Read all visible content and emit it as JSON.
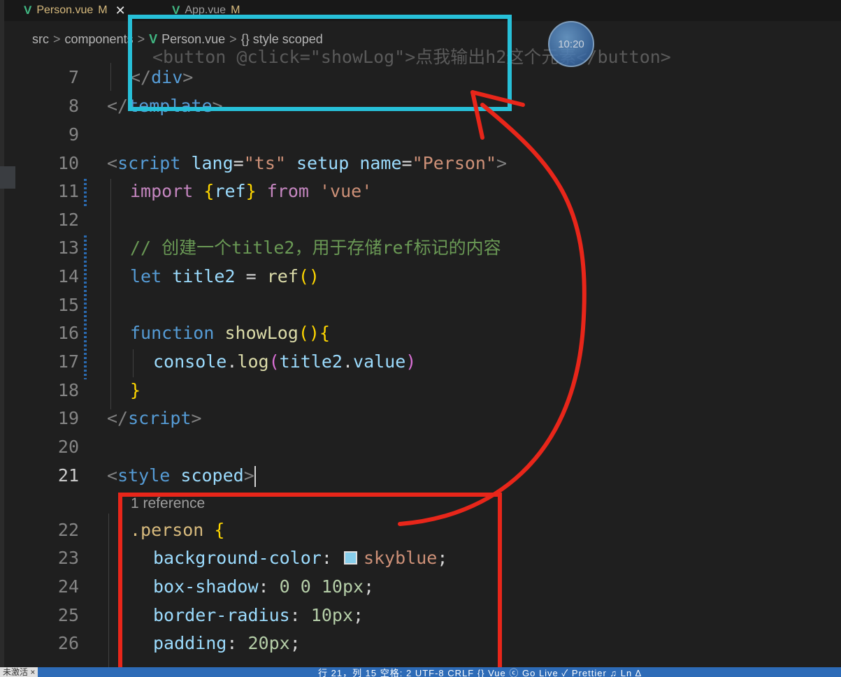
{
  "tabs": [
    {
      "label": "Person.vue",
      "modified": "M",
      "close": "✕"
    },
    {
      "label": "App.vue",
      "modified": "M"
    }
  ],
  "breadcrumb": {
    "src": "src",
    "components": "components",
    "file": "Person.vue",
    "symbol": "{} style scoped"
  },
  "ghost_line": "<button @click=\"showLog\">点我输出h2这个元素</button>",
  "lines": {
    "l7": {
      "num": "7",
      "close": "</",
      "tag": "div",
      "end": ">"
    },
    "l8": {
      "num": "8",
      "close": "</",
      "tag": "template",
      "end": ">"
    },
    "l9": {
      "num": "9"
    },
    "l10": {
      "num": "10",
      "open": "<",
      "tag": "script",
      "a1": "lang",
      "eq": "=",
      "v1": "\"ts\"",
      "a2": "setup",
      "a3": "name",
      "v3": "\"Person\"",
      "end": ">"
    },
    "l11": {
      "num": "11",
      "kw": "import",
      "lb": "{",
      "name": "ref",
      "rb": "}",
      "from": "from",
      "mod": "'vue'"
    },
    "l12": {
      "num": "12"
    },
    "l13": {
      "num": "13",
      "comment": "// 创建一个title2，用于存储ref标记的内容"
    },
    "l14": {
      "num": "14",
      "kw": "let",
      "name": "title2",
      "eq": "=",
      "fn": "ref",
      "parens": "()"
    },
    "l15": {
      "num": "15"
    },
    "l16": {
      "num": "16",
      "kw": "function",
      "fn": "showLog",
      "parens": "()",
      "brace": "{"
    },
    "l17": {
      "num": "17",
      "obj": "console",
      "dot": ".",
      "fn": "log",
      "lp": "(",
      "arg": "title2",
      "dot2": ".",
      "prop": "value",
      "rp": ")"
    },
    "l18": {
      "num": "18",
      "brace": "}"
    },
    "l19": {
      "num": "19",
      "close": "</",
      "tag": "script",
      "end": ">"
    },
    "l20": {
      "num": "20"
    },
    "l21": {
      "num": "21",
      "open": "<",
      "tag": "style",
      "attr": "scoped",
      "end": ">"
    },
    "codelens": "1 reference",
    "l22": {
      "num": "22",
      "sel": ".person",
      "brace": "{"
    },
    "l23": {
      "num": "23",
      "prop": "background-color",
      "colon": ":",
      "val": "skyblue",
      "semi": ";"
    },
    "l24": {
      "num": "24",
      "prop": "box-shadow",
      "colon": ":",
      "val": "0 0 10px",
      "semi": ";"
    },
    "l25": {
      "num": "25",
      "prop": "border-radius",
      "colon": ":",
      "val": "10px",
      "semi": ";"
    },
    "l26": {
      "num": "26",
      "prop": "padding",
      "colon": ":",
      "val": "20px",
      "semi": ";"
    }
  },
  "timer": "10:20",
  "status": {
    "left": "未激活 ×",
    "right": "行 21，列 15    空格: 2    UTF-8    CRLF    {} Vue    ⓒ Go Live    ✓ Prettier    ♫ Ln  ∆"
  },
  "colors": {
    "cyan_highlight": "#27c0d8",
    "red_highlight": "#e8261a",
    "swatch": "#87ceeb"
  }
}
